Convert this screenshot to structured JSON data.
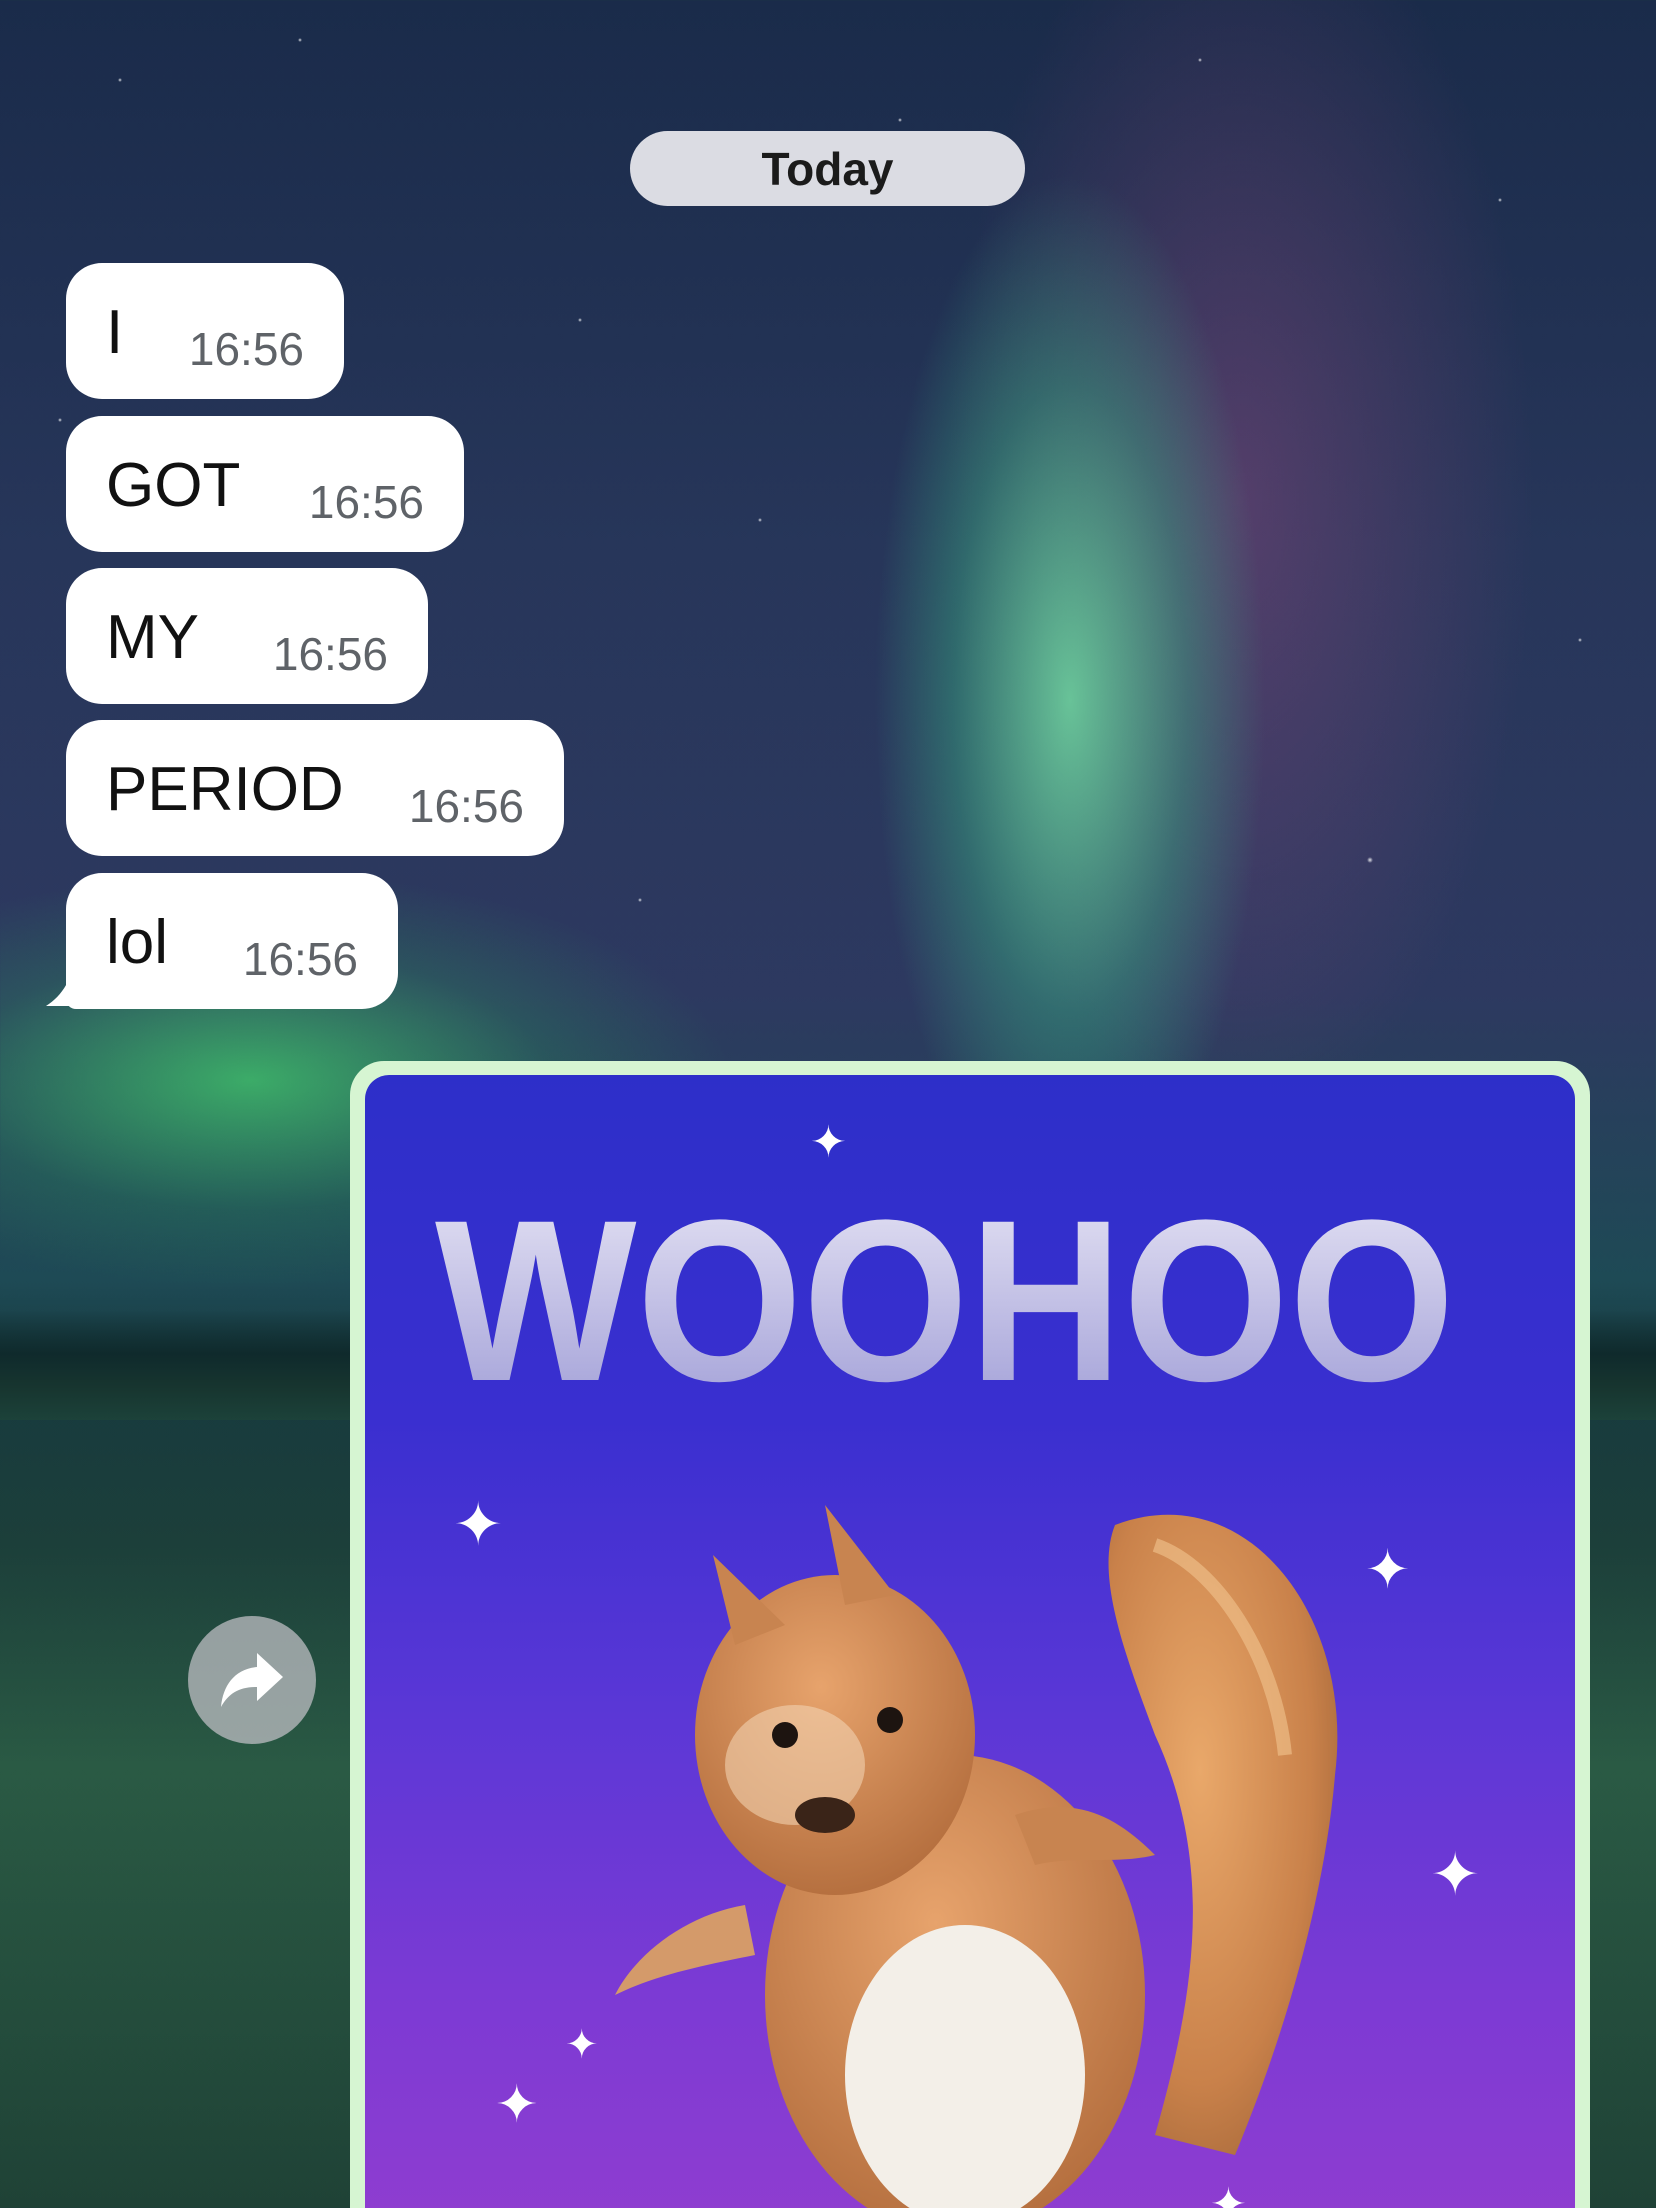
{
  "date_separator": "Today",
  "messages": [
    {
      "text": "I",
      "time": "16:56"
    },
    {
      "text": "GOT",
      "time": "16:56"
    },
    {
      "text": "MY",
      "time": "16:56"
    },
    {
      "text": "PERIOD",
      "time": "16:56"
    },
    {
      "text": "lol",
      "time": "16:56"
    }
  ],
  "sticker": {
    "text": "WOOHOO"
  },
  "colors": {
    "bubble": "#ffffff",
    "sticker_border": "#d6f5d2",
    "sticker_bg_top": "#2d2fc9",
    "sticker_bg_bottom": "#8f3dd0"
  },
  "icons": {
    "forward": "share-forward-icon"
  }
}
